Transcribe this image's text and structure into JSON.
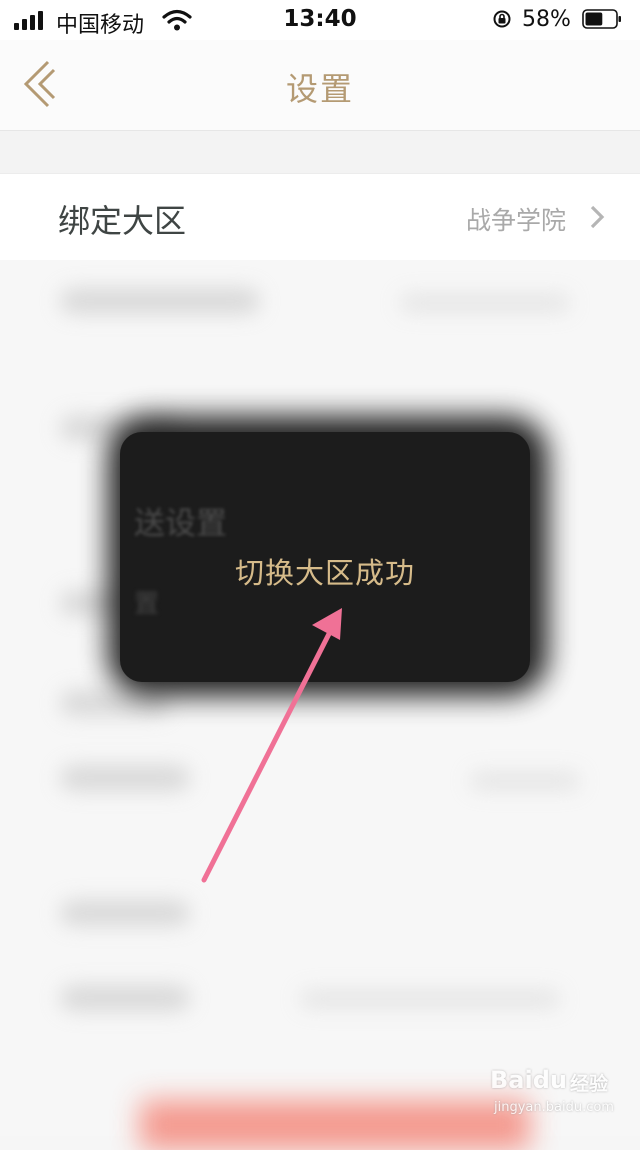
{
  "status_bar": {
    "carrier": "中国移动",
    "time": "13:40",
    "battery_percent": "58%",
    "battery_level": 0.58,
    "icons": [
      "signal-icon",
      "wifi-icon",
      "orientation-lock-icon",
      "battery-icon"
    ]
  },
  "nav": {
    "title": "设置",
    "back_icon": "back-chevron-icon"
  },
  "settings": {
    "bind_region": {
      "label": "绑定大区",
      "value": "战争学院",
      "chevron": "chevron-right-icon"
    }
  },
  "toast": {
    "message": "切换大区成功",
    "obscured_text": [
      "送设置",
      "置"
    ]
  },
  "annotation": {
    "arrow_color": "#f07196"
  },
  "watermark": {
    "brand": "Baidu",
    "product": "经验",
    "url": "jingyan.baidu.com"
  },
  "colors": {
    "accent_gold": "#b49a73",
    "toast_text": "#d6bb8a",
    "toast_bg": "#1c1c1c"
  }
}
